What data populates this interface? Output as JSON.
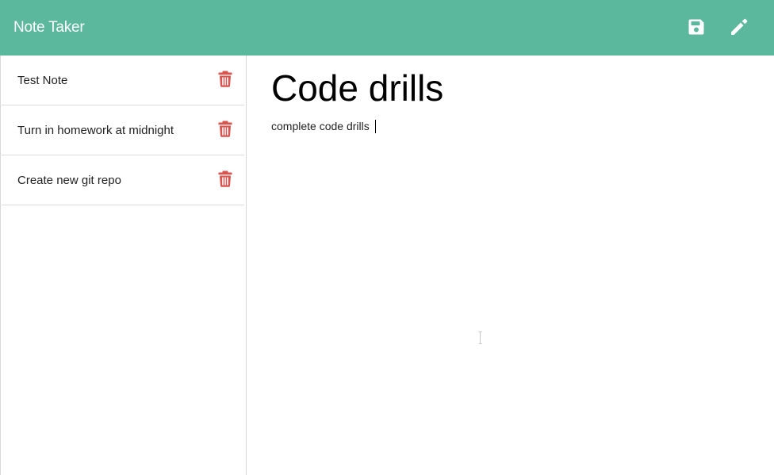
{
  "app": {
    "brand": "Note Taker"
  },
  "toolbar": {
    "save_icon": "save-icon",
    "new_note_icon": "pencil-icon",
    "icon_color": "#ffffff",
    "bar_color": "#5bb89c"
  },
  "sidebar": {
    "notes": [
      {
        "title": "Test Note",
        "delete_icon": "trash-icon"
      },
      {
        "title": "Turn in homework at midnight",
        "delete_icon": "trash-icon"
      },
      {
        "title": "Create new git repo",
        "delete_icon": "trash-icon"
      }
    ],
    "delete_color": "#d9534f"
  },
  "editor": {
    "title_value": "Code drills",
    "body_value": "complete code drills"
  }
}
